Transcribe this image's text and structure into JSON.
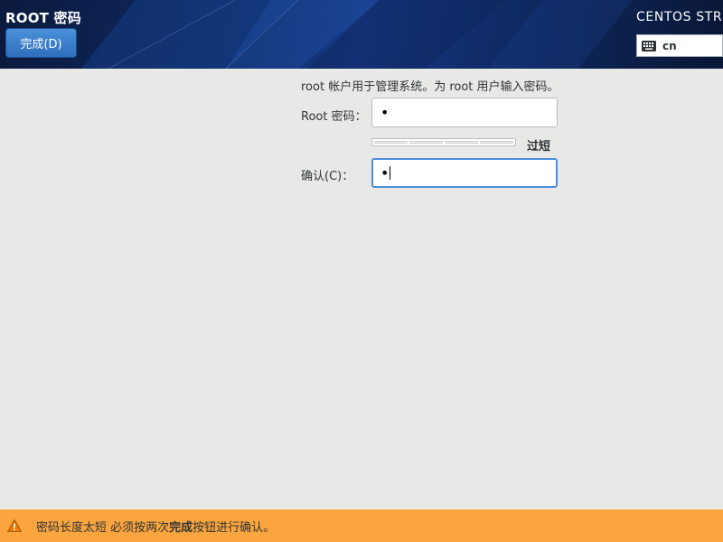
{
  "header": {
    "page_title": "ROOT 密码",
    "done_label": "完成(D)",
    "product_name": "CENTOS STREAM",
    "keyboard_layout": "cn"
  },
  "form": {
    "description": "root 帐户用于管理系统。为 root 用户输入密码。",
    "root_password_label": "Root 密码：",
    "root_password_value": "•",
    "strength_label": "过短",
    "strength_level": 0,
    "confirm_label": "确认(C)：",
    "confirm_value": "•"
  },
  "warning": {
    "text_before": "密码长度太短 必须按两次",
    "text_bold": "完成",
    "text_after": "按钮进行确认。"
  },
  "colors": {
    "header_bg": "#102c66",
    "done_button": "#3b7fcf",
    "warning_bar": "#fba53e",
    "focus_border": "#4a90d9"
  },
  "icons": {
    "keyboard": "keyboard-icon",
    "warning": "warning-triangle-icon"
  }
}
